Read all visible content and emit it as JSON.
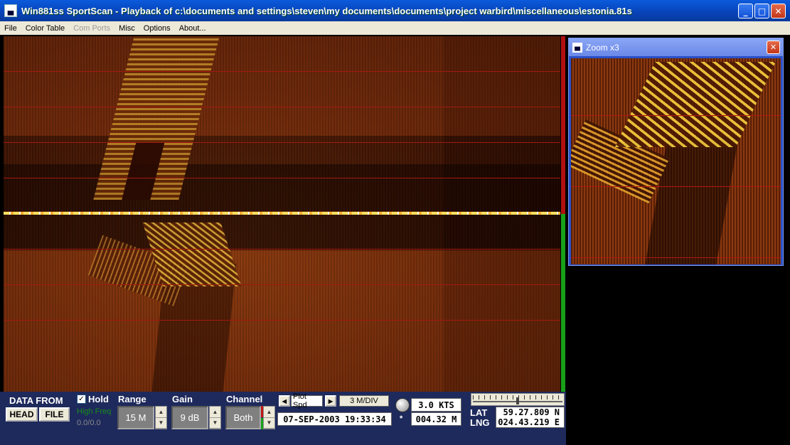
{
  "window": {
    "title": "Win881ss SportScan - Playback of c:\\documents and settings\\steven\\my documents\\documents\\project warbird\\miscellaneous\\estonia.81s",
    "app_icon_glyph": "▄"
  },
  "menu": {
    "items": [
      {
        "label": "File",
        "enabled": true
      },
      {
        "label": "Color Table",
        "enabled": true
      },
      {
        "label": "Com Ports",
        "enabled": false
      },
      {
        "label": "Misc",
        "enabled": true
      },
      {
        "label": "Options",
        "enabled": true
      },
      {
        "label": "About...",
        "enabled": true
      }
    ]
  },
  "signal_meter": {
    "level": 0.5,
    "low_color": "#18a018",
    "high_color": "#b01010"
  },
  "zoom_window": {
    "title": "Zoom x3"
  },
  "controls": {
    "data_from_label": "DATA FROM",
    "head_button": "HEAD",
    "file_button": "FILE",
    "hold_label": "Hold",
    "hold_checked": true,
    "high_freq_label": "High Freq",
    "high_freq_value": "0.0/0.0",
    "range_label": "Range",
    "range_value": "15 M",
    "gain_label": "Gain",
    "gain_value": "9 dB",
    "channel_label": "Channel",
    "channel_value": "Both",
    "plot_speed_label": "Plot Spd",
    "div_value": "3 M/DIV",
    "datetime": "07-SEP-2003  19:33:34",
    "speed": "3.0 KTS",
    "distance": "004.32 M",
    "lat_label": "LAT",
    "lng_label": "LNG",
    "lat_value": "59.27.809 N",
    "lng_value": "024.43.219 E",
    "slider_position": 0.5
  },
  "colors": {
    "accent_red": "#a01a10",
    "panel_bg": "#1e2a5c",
    "high_freq_green": "#1a8c1a"
  }
}
